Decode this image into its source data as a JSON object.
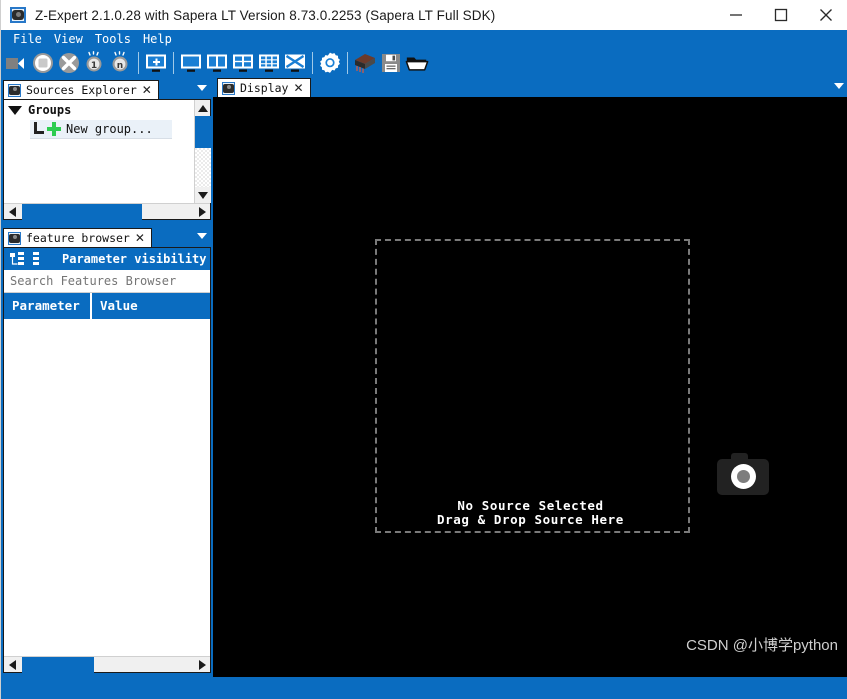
{
  "window": {
    "title": "Z-Expert 2.1.0.28 with Sapera LT Version 8.73.0.2253 (Sapera LT Full SDK)",
    "app_icon": "camera-icon",
    "minimize_label": "minimize-icon",
    "maximize_label": "maximize-icon",
    "close_label": "close-icon"
  },
  "menubar": {
    "items": [
      {
        "label": "File"
      },
      {
        "label": "View"
      },
      {
        "label": "Tools"
      },
      {
        "label": "Help"
      }
    ]
  },
  "toolbar": {
    "buttons": [
      {
        "name": "grab-video-icon",
        "tooltip": "Grab"
      },
      {
        "name": "snap-stop-icon",
        "tooltip": "Snap"
      },
      {
        "name": "abort-icon",
        "tooltip": "Abort"
      },
      {
        "name": "one-shot-icon",
        "tooltip": "One Shot"
      },
      {
        "name": "continuous-icon",
        "tooltip": "Continuous"
      },
      {
        "name": "add-display-icon",
        "tooltip": "New Display"
      },
      {
        "name": "single-view-icon",
        "tooltip": "Single View"
      },
      {
        "name": "two-column-view-icon",
        "tooltip": "Two Column View"
      },
      {
        "name": "quad-view-icon",
        "tooltip": "Quad View"
      },
      {
        "name": "grid-view-icon",
        "tooltip": "Grid View"
      },
      {
        "name": "cross-view-icon",
        "tooltip": "Cross View"
      },
      {
        "name": "settings-gear-icon",
        "tooltip": "Settings"
      },
      {
        "name": "stack-icon",
        "tooltip": "Stack"
      },
      {
        "name": "save-icon",
        "tooltip": "Save"
      },
      {
        "name": "open-folder-icon",
        "tooltip": "Open"
      }
    ]
  },
  "sources_explorer": {
    "tab_title": "Sources Explorer",
    "tab_close": "✕",
    "tree": {
      "root_label": "Groups",
      "children": [
        {
          "label": "New group...",
          "icon": "plus-icon"
        }
      ]
    }
  },
  "feature_browser": {
    "tab_title": "feature browser",
    "tab_close": "✕",
    "visibility_label": "Parameter visibility",
    "search_placeholder": "Search Features Browser",
    "columns": [
      {
        "label": "Parameter"
      },
      {
        "label": "Value"
      }
    ],
    "rows": []
  },
  "display": {
    "tab_title": "Display",
    "tab_close": "✕",
    "empty_title": "No Source Selected",
    "empty_subtitle": "Drag & Drop Source Here",
    "icon": "camera-icon"
  },
  "watermark": {
    "text": "CSDN @小博学python"
  },
  "colors": {
    "accent_blue": "#0a6cc0",
    "display_background": "#000000",
    "tree_highlight": "#eaf1f8",
    "plus_green": "#2ecc50"
  }
}
